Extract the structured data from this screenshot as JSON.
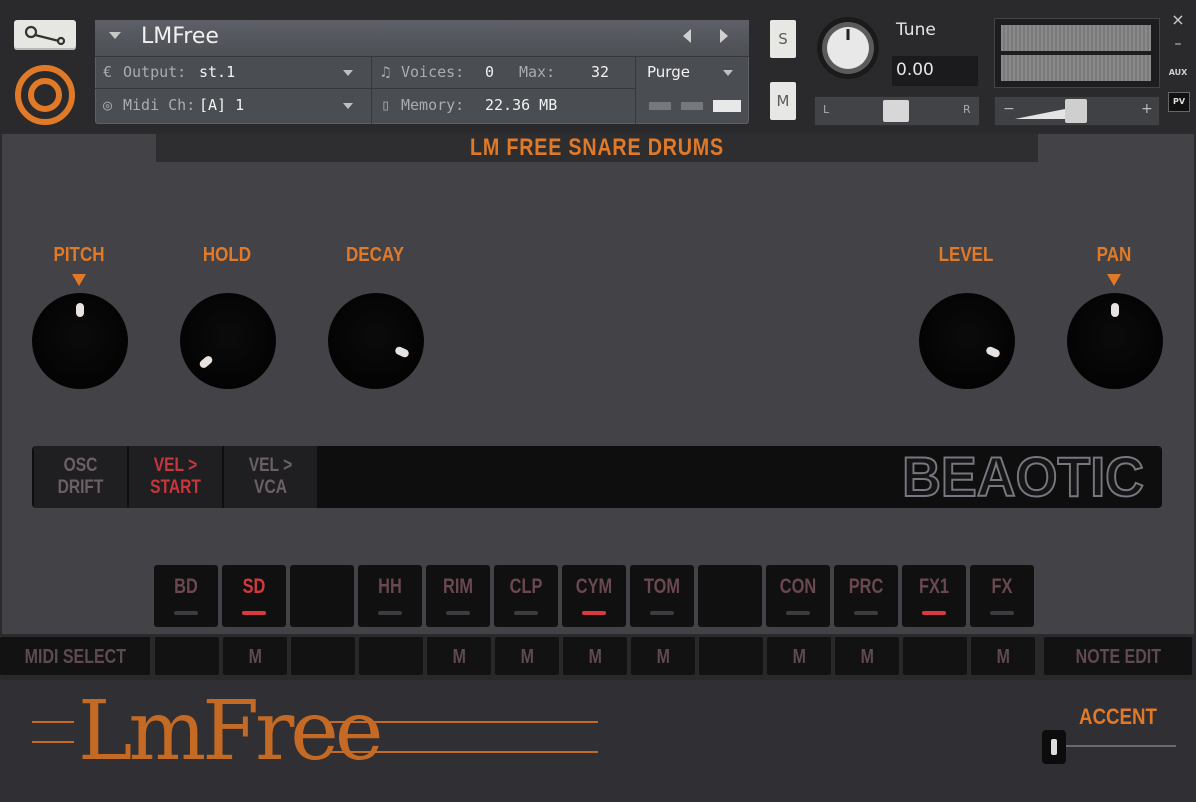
{
  "header": {
    "instrument_name": "LMFree",
    "output_label": "Output:",
    "output_value": "st.1",
    "midi_label": "Midi Ch:",
    "midi_value": "[A] 1",
    "voices_label": "Voices:",
    "voices_value": "0",
    "max_label": "Max:",
    "max_value": "32",
    "memory_label": "Memory:",
    "memory_value": "22.36 MB",
    "purge_label": "Purge",
    "solo_label": "S",
    "mute_label": "M",
    "tune_label": "Tune",
    "tune_value": "0.00",
    "pan_left": "L",
    "pan_right": "R",
    "aux_label": "AUX",
    "pv_label": "PV",
    "close_label": "×",
    "minimize_label": "–",
    "vol_minus": "−",
    "vol_plus": "+"
  },
  "main": {
    "title": "LM FREE SNARE DRUMS",
    "knobs": [
      {
        "label": "PITCH",
        "has_arrow": true
      },
      {
        "label": "HOLD",
        "has_arrow": false
      },
      {
        "label": "DECAY",
        "has_arrow": false
      },
      {
        "label": "LEVEL",
        "has_arrow": false
      },
      {
        "label": "PAN",
        "has_arrow": true
      }
    ],
    "options": [
      {
        "line1": "OSC",
        "line2": "DRIFT",
        "active": false
      },
      {
        "line1": "VEL >",
        "line2": "START",
        "active": true
      },
      {
        "line1": "VEL >",
        "line2": "VCA",
        "active": false
      }
    ],
    "brand": "BEAOTIC",
    "pads": [
      {
        "label": "BD",
        "active": false,
        "indicator": true,
        "lit": false
      },
      {
        "label": "SD",
        "active": true,
        "indicator": true,
        "lit": true
      },
      {
        "label": "",
        "active": false,
        "indicator": false,
        "lit": false
      },
      {
        "label": "HH",
        "active": false,
        "indicator": true,
        "lit": false
      },
      {
        "label": "RIM",
        "active": false,
        "indicator": true,
        "lit": false
      },
      {
        "label": "CLP",
        "active": false,
        "indicator": true,
        "lit": false
      },
      {
        "label": "CYM",
        "active": false,
        "indicator": true,
        "lit": true
      },
      {
        "label": "TOM",
        "active": false,
        "indicator": true,
        "lit": false
      },
      {
        "label": "",
        "active": false,
        "indicator": false,
        "lit": false
      },
      {
        "label": "CON",
        "active": false,
        "indicator": true,
        "lit": false
      },
      {
        "label": "PRC",
        "active": false,
        "indicator": true,
        "lit": false
      },
      {
        "label": "FX1",
        "active": false,
        "indicator": true,
        "lit": true
      },
      {
        "label": "FX",
        "active": false,
        "indicator": true,
        "lit": false
      }
    ]
  },
  "midi_row": {
    "midi_select": "MIDI SELECT",
    "note_edit": "NOTE EDIT",
    "cells": [
      "",
      "M",
      "",
      "",
      "M",
      "M",
      "M",
      "M",
      "",
      "M",
      "M",
      "",
      "M"
    ]
  },
  "footer": {
    "logo_text": "LmFree",
    "accent_label": "ACCENT"
  },
  "colors": {
    "accent_orange": "#e07a29",
    "active_red": "#d03a3f",
    "panel_bg": "#434247"
  }
}
